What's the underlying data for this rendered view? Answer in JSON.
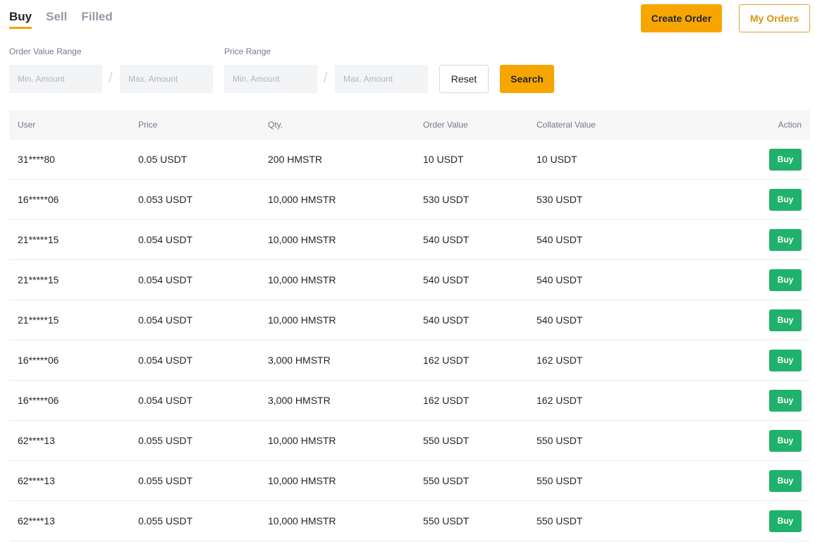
{
  "tabs": [
    {
      "label": "Buy",
      "active": true
    },
    {
      "label": "Sell",
      "active": false
    },
    {
      "label": "Filled",
      "active": false
    }
  ],
  "header": {
    "create_order": "Create Order",
    "my_orders": "My Orders"
  },
  "filters": {
    "order_value_label": "Order Value Range",
    "price_range_label": "Price Range",
    "min_placeholder": "Min. Amount",
    "max_placeholder": "Max. Amount",
    "separator": "/",
    "reset": "Reset",
    "search": "Search"
  },
  "colors": {
    "accent": "#f7a600",
    "buy": "#20b26c"
  },
  "table": {
    "columns": [
      "User",
      "Price",
      "Qty.",
      "Order Value",
      "Collateral Value",
      "Action"
    ],
    "rows": [
      {
        "user": "31****80",
        "price": "0.05 USDT",
        "qty": "200 HMSTR",
        "order_value": "10 USDT",
        "collateral": "10 USDT",
        "action": "Buy"
      },
      {
        "user": "16*****06",
        "price": "0.053 USDT",
        "qty": "10,000 HMSTR",
        "order_value": "530 USDT",
        "collateral": "530 USDT",
        "action": "Buy"
      },
      {
        "user": "21*****15",
        "price": "0.054 USDT",
        "qty": "10,000 HMSTR",
        "order_value": "540 USDT",
        "collateral": "540 USDT",
        "action": "Buy"
      },
      {
        "user": "21*****15",
        "price": "0.054 USDT",
        "qty": "10,000 HMSTR",
        "order_value": "540 USDT",
        "collateral": "540 USDT",
        "action": "Buy"
      },
      {
        "user": "21*****15",
        "price": "0.054 USDT",
        "qty": "10,000 HMSTR",
        "order_value": "540 USDT",
        "collateral": "540 USDT",
        "action": "Buy"
      },
      {
        "user": "16*****06",
        "price": "0.054 USDT",
        "qty": "3,000 HMSTR",
        "order_value": "162 USDT",
        "collateral": "162 USDT",
        "action": "Buy"
      },
      {
        "user": "16*****06",
        "price": "0.054 USDT",
        "qty": "3,000 HMSTR",
        "order_value": "162 USDT",
        "collateral": "162 USDT",
        "action": "Buy"
      },
      {
        "user": "62****13",
        "price": "0.055 USDT",
        "qty": "10,000 HMSTR",
        "order_value": "550 USDT",
        "collateral": "550 USDT",
        "action": "Buy"
      },
      {
        "user": "62****13",
        "price": "0.055 USDT",
        "qty": "10,000 HMSTR",
        "order_value": "550 USDT",
        "collateral": "550 USDT",
        "action": "Buy"
      },
      {
        "user": "62****13",
        "price": "0.055 USDT",
        "qty": "10,000 HMSTR",
        "order_value": "550 USDT",
        "collateral": "550 USDT",
        "action": "Buy"
      }
    ]
  }
}
